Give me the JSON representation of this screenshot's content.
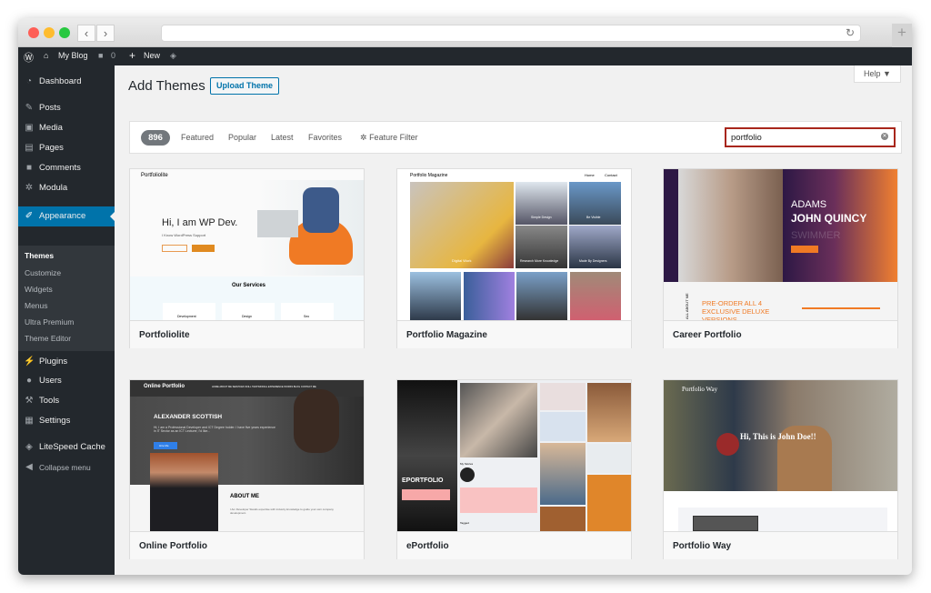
{
  "browser": {
    "reload_icon": "reload-icon",
    "new_tab_icon": "plus-icon"
  },
  "adminbar": {
    "site": "My Blog",
    "comments": "0",
    "new": "New"
  },
  "sidebar": {
    "items": [
      {
        "label": "Dashboard",
        "icon": "dashboard-icon"
      },
      {
        "label": "Posts",
        "icon": "pin-icon"
      },
      {
        "label": "Media",
        "icon": "media-icon"
      },
      {
        "label": "Pages",
        "icon": "pages-icon"
      },
      {
        "label": "Comments",
        "icon": "comment-icon"
      },
      {
        "label": "Modula",
        "icon": "gear-icon"
      },
      {
        "label": "Appearance",
        "icon": "brush-icon"
      },
      {
        "label": "Plugins",
        "icon": "plugin-icon"
      },
      {
        "label": "Users",
        "icon": "user-icon"
      },
      {
        "label": "Tools",
        "icon": "wrench-icon"
      },
      {
        "label": "Settings",
        "icon": "settings-icon"
      },
      {
        "label": "LiteSpeed Cache",
        "icon": "diamond-icon"
      },
      {
        "label": "Collapse menu",
        "icon": "collapse-icon"
      }
    ],
    "submenu": [
      "Themes",
      "Customize",
      "Widgets",
      "Menus",
      "Ultra Premium",
      "Theme Editor"
    ]
  },
  "header": {
    "title": "Add Themes",
    "upload": "Upload Theme",
    "help": "Help ▼"
  },
  "filter": {
    "count": "896",
    "tabs": [
      "Featured",
      "Popular",
      "Latest",
      "Favorites"
    ],
    "feature_filter": "Feature Filter",
    "search_value": "portfolio"
  },
  "themes": [
    {
      "name": "Portfoliolite",
      "preview": {
        "logo": "Portfoliolite",
        "headline": "Hi, I am WP Dev.",
        "sub": "I Know WordPress Support",
        "section": "Our Services",
        "services": [
          "Development",
          "Design",
          "Seo"
        ]
      }
    },
    {
      "name": "Portfolio Magazine",
      "preview": {
        "logo": "Portfolio Magazine",
        "nav": [
          "Home",
          "Contact"
        ],
        "tiles": [
          "Digital Work",
          "Simple Design",
          "Be Visible",
          "Research More Knowledge",
          "Made By Designers"
        ]
      }
    },
    {
      "name": "Career Portfolio",
      "preview": {
        "first": "ADAMS",
        "last": "JOHN QUINCY",
        "ghost": "SWIMMER",
        "promo": "PRE-ORDER ALL 4 EXCLUSIVE DELUXE VERSIONS",
        "side": "ALL ABOUT ME"
      }
    },
    {
      "name": "Online Portfolio",
      "preview": {
        "logo": "Online Portfolio",
        "nav": "HOME  ABOUT ME  SERVICES  SKILL  TESTIMONIAL  EXPERIENCE  WORKS  BLOG  CONTACT ME",
        "headline": "ALEXANDER SCOTTISH",
        "sub": "Hi, I am a Professional Developer and ICT Degree holder. I have five years experience in IT Sector as an ICT Lecturer, I'd like...",
        "button": "Hire Me",
        "about": "ABOUT ME",
        "about_text": "I Am Developer Stands expertise with industry knowledge to guide your own company development."
      }
    },
    {
      "name": "ePortfolio",
      "preview": {
        "title": "EPORTFOLIO",
        "stories": "My Stories",
        "tagged": "Tagged"
      }
    },
    {
      "name": "Portfolio Way",
      "preview": {
        "logo": "Portfolio Way",
        "headline": "Hi, This is John Doe!!"
      }
    }
  ]
}
